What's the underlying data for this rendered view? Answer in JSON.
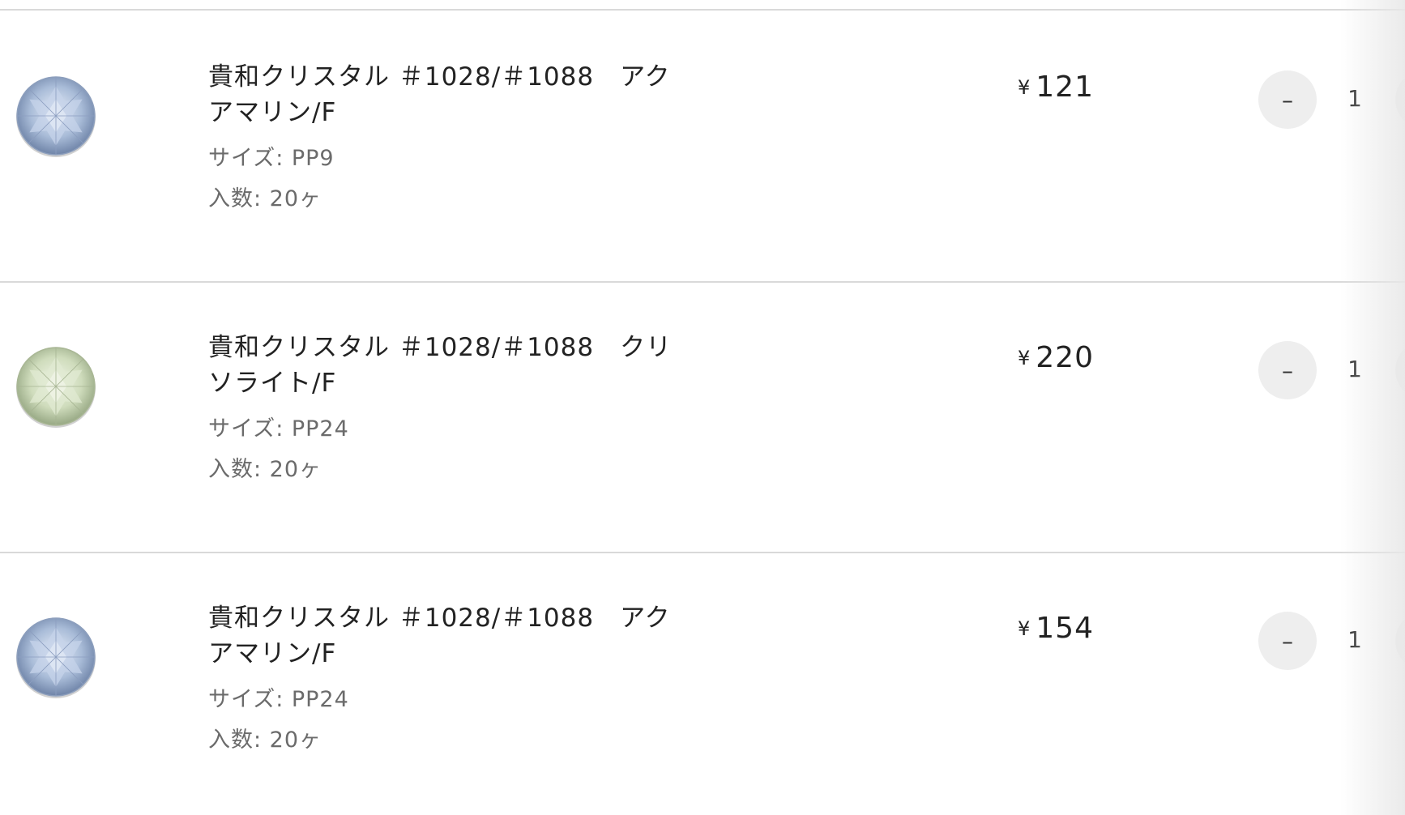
{
  "cart": {
    "items": [
      {
        "title": "貴和クリスタル ＃1028/＃1088　アクアマリン/F",
        "size_label": "サイズ: PP9",
        "count_label": "入数: 20ヶ",
        "currency": "¥",
        "price": "121",
        "quantity": "1",
        "decrement_label": "–",
        "stone_color": "#a9bcd8",
        "stone_icon": "crystal-aquamarine-icon"
      },
      {
        "title": "貴和クリスタル ＃1028/＃1088　クリソライト/F",
        "size_label": "サイズ: PP24",
        "count_label": "入数: 20ヶ",
        "currency": "¥",
        "price": "220",
        "quantity": "1",
        "decrement_label": "–",
        "stone_color": "#cfdcbc",
        "stone_icon": "crystal-chrysolite-icon"
      },
      {
        "title": "貴和クリスタル ＃1028/＃1088　アクアマリン/F",
        "size_label": "サイズ: PP24",
        "count_label": "入数: 20ヶ",
        "currency": "¥",
        "price": "154",
        "quantity": "1",
        "decrement_label": "–",
        "stone_color": "#a9bcd8",
        "stone_icon": "crystal-aquamarine-icon"
      }
    ]
  }
}
